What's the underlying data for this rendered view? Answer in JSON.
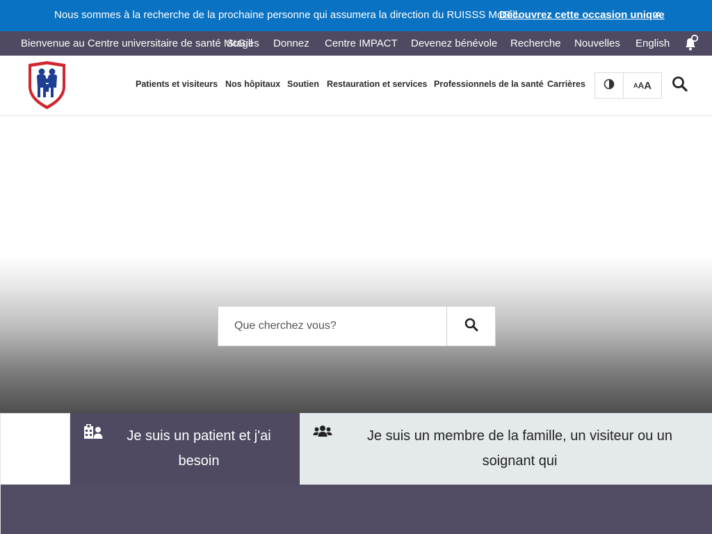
{
  "announcement": {
    "message": "Nous sommes à la recherche de la prochaine personne qui assumera la direction du RUISSS McGill.",
    "cta": "Découvrez cette occasion unique",
    "close": "×"
  },
  "utility_bar": {
    "welcome": "Bienvenue au Centre universitaire de santé McGill",
    "links": [
      "Stages",
      "Donnez",
      "Centre IMPACT",
      "Devenez bénévole",
      "Recherche",
      "Nouvelles",
      "English"
    ]
  },
  "main_nav": {
    "items": [
      "Patients et visiteurs",
      "Nos hôpitaux",
      "Soutien",
      "Restauration et services",
      "Professionnels de la santé",
      "Carrières"
    ],
    "font_size_glyphs": [
      "A",
      "A",
      "A"
    ]
  },
  "hero": {
    "search_placeholder": "Que cherchez vous?"
  },
  "audience_tabs": {
    "patient": "Je suis un patient et j'ai besoin",
    "family": "Je suis un membre de la famille, un visiteur ou un soignant qui"
  },
  "colors": {
    "announcement_bg": "#0a72c2",
    "utility_bg": "#4f4a61",
    "active_tab_bg": "#4f4a61",
    "inactive_tab_bg": "#e4e9ec",
    "logo_red": "#d0262e",
    "logo_blue": "#1d3f93"
  }
}
